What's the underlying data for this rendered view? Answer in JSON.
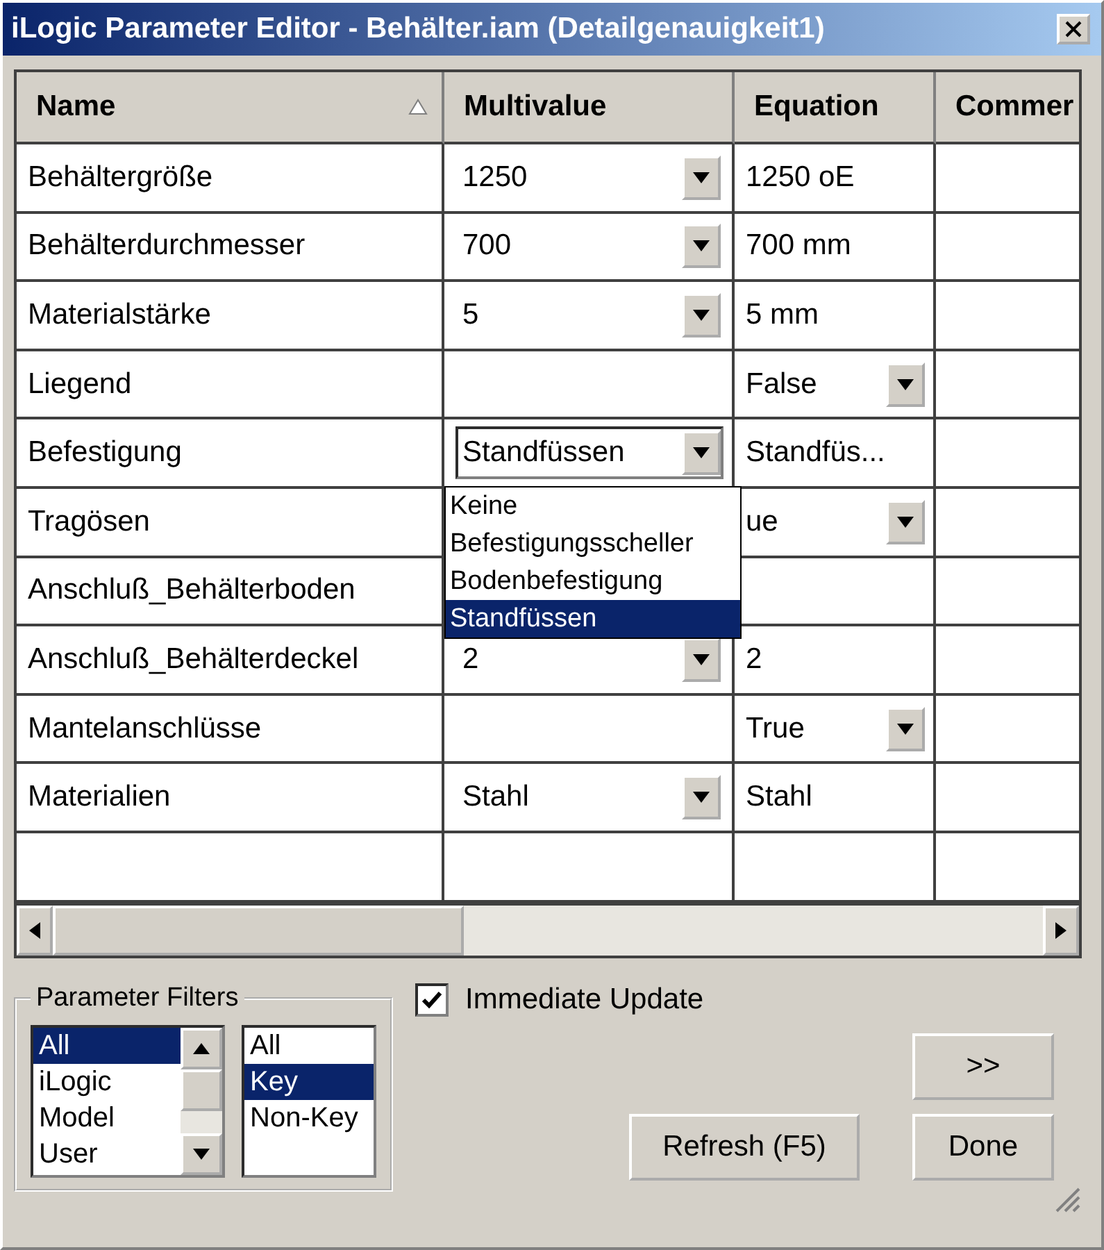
{
  "window": {
    "title": "iLogic Parameter Editor - Behälter.iam (Detailgenauigkeit1)"
  },
  "table": {
    "columns": [
      {
        "label": "Name",
        "sorted": true
      },
      {
        "label": "Multivalue"
      },
      {
        "label": "Equation"
      },
      {
        "label": "Commer"
      }
    ],
    "rows": [
      {
        "name": "Behältergröße",
        "multivalue": {
          "value": "1250",
          "active": false
        },
        "equation": {
          "value": "1250 oE",
          "dropdown": false
        }
      },
      {
        "name": "Behälterdurchmesser",
        "multivalue": {
          "value": "700",
          "active": false
        },
        "equation": {
          "value": "700 mm",
          "dropdown": false
        }
      },
      {
        "name": "Materialstärke",
        "multivalue": {
          "value": "5",
          "active": false
        },
        "equation": {
          "value": "5 mm",
          "dropdown": false
        }
      },
      {
        "name": "Liegend",
        "equation": {
          "value": "False",
          "dropdown": true
        }
      },
      {
        "name": "Befestigung",
        "multivalue": {
          "value": "Standfüssen",
          "active": true
        },
        "equation": {
          "value": "Standfüs...",
          "dropdown": false
        }
      },
      {
        "name": "Tragösen",
        "equation": {
          "value": "ue",
          "dropdown": true
        }
      },
      {
        "name": "Anschluß_Behälterboden"
      },
      {
        "name": "Anschluß_Behälterdeckel",
        "multivalue": {
          "value": "2",
          "active": false
        },
        "equation": {
          "value": "2",
          "dropdown": false
        }
      },
      {
        "name": "Mantelanschlüsse",
        "equation": {
          "value": "True",
          "dropdown": true
        }
      },
      {
        "name": "Materialien",
        "multivalue": {
          "value": "Stahl",
          "active": false
        },
        "equation": {
          "value": "Stahl",
          "dropdown": false
        }
      }
    ]
  },
  "open_list": {
    "items": [
      {
        "label": "Keine",
        "selected": false
      },
      {
        "label": "Befestigungsscheller",
        "selected": false
      },
      {
        "label": "Bodenbefestigung",
        "selected": false
      },
      {
        "label": "Standfüssen",
        "selected": true
      }
    ]
  },
  "filters": {
    "title": "Parameter Filters",
    "type_list": [
      {
        "label": "All",
        "selected": true
      },
      {
        "label": "iLogic",
        "selected": false
      },
      {
        "label": "Model",
        "selected": false
      },
      {
        "label": "User",
        "selected": false
      }
    ],
    "key_list": [
      {
        "label": "All",
        "selected": false
      },
      {
        "label": "Key",
        "selected": true
      },
      {
        "label": "Non-Key",
        "selected": false
      }
    ]
  },
  "immediate_update": {
    "label": "Immediate Update",
    "checked": true
  },
  "buttons": [
    {
      "label": ">>",
      "kind": "expand"
    },
    {
      "label": "Refresh (F5)",
      "kind": "refresh"
    },
    {
      "label": "Done",
      "kind": "done"
    }
  ]
}
